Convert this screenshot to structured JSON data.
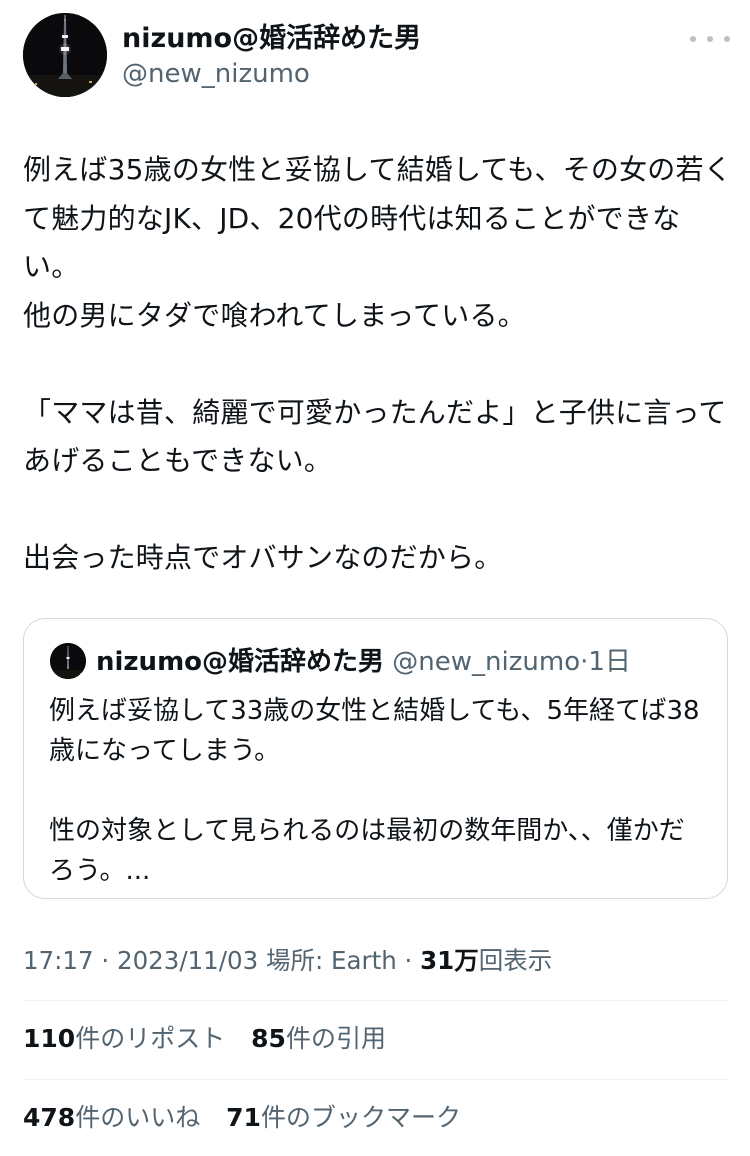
{
  "author": {
    "display_name": "nizumo@婚活辞めた男",
    "handle": "@new_nizumo"
  },
  "tweet": {
    "text": "例えば35歳の女性と妥協して結婚しても、その女の若くて魅力的なJK、JD、20代の時代は知ることができない。\n他の男にタダで喰われてしまっている。\n\n「ママは昔、綺麗で可愛かったんだよ」と子供に言ってあげることもできない。\n\n出会った時点でオバサンなのだから。"
  },
  "quote": {
    "display_name": "nizumo@婚活辞めた男",
    "handle": "@new_nizumo",
    "separator": "·",
    "time": "1日",
    "text": "例えば妥協して33歳の女性と結婚しても、5年経てば38歳になってしまう。\n\n性の対象として見られるのは最初の数年間か、、僅かだろう。..."
  },
  "meta": {
    "time": "17:17",
    "sep1": " · ",
    "date": "2023/11/03",
    "location": " 場所: Earth",
    "sep2": " · ",
    "views": "31万",
    "views_label": "回表示"
  },
  "stats": {
    "reposts_count": "110",
    "reposts_label": "件のリポスト",
    "quotes_count": "85",
    "quotes_label": "件の引用",
    "likes_count": "478",
    "likes_label": "件のいいね",
    "bookmarks_count": "71",
    "bookmarks_label": "件のブックマーク"
  },
  "icons": {
    "more": "more-horizontal-icon"
  },
  "colors": {
    "text": "#0f1419",
    "secondary": "#536471",
    "border": "#cfd9de"
  }
}
